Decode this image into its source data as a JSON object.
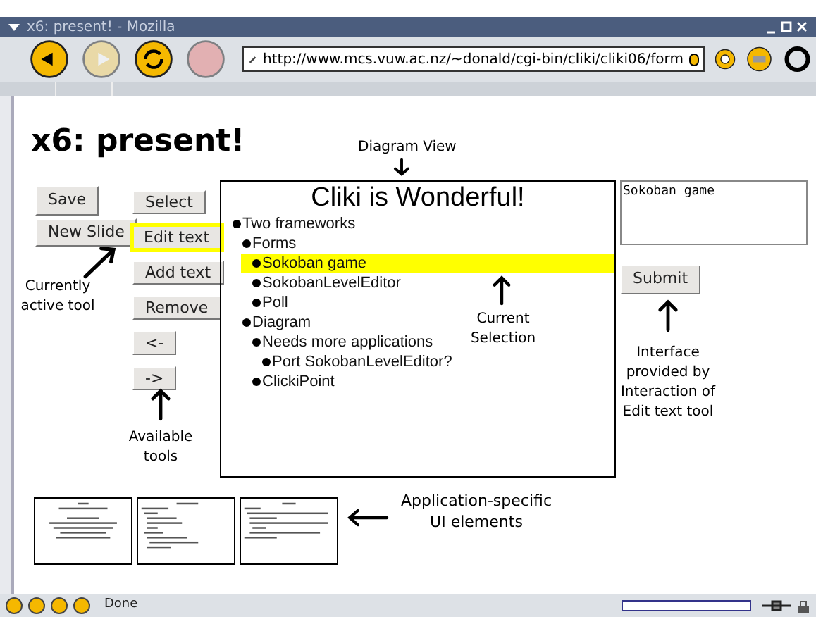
{
  "window": {
    "title": "x6: present! - Mozilla"
  },
  "toolbar": {
    "buttons": [
      {
        "kind": "back",
        "disabled": false
      },
      {
        "kind": "forward",
        "disabled": true
      },
      {
        "kind": "reload",
        "disabled": false
      },
      {
        "kind": "stop",
        "disabled": true
      }
    ],
    "url": "http://www.mcs.vuw.ac.nz/~donald/cgi-bin/cliki/cliki06/form"
  },
  "page": {
    "heading": "x6: present!",
    "slide_buttons": [
      "Save",
      "New Slide"
    ],
    "tools": [
      {
        "label": "Select",
        "selected": false
      },
      {
        "label": "Edit text",
        "selected": true
      },
      {
        "label": "Add text",
        "selected": false
      },
      {
        "label": "Remove",
        "selected": false
      },
      {
        "label": "<-",
        "selected": false
      },
      {
        "label": "->",
        "selected": false
      }
    ],
    "diagram": {
      "title": "Cliki is Wonderful!",
      "items": [
        {
          "text": "Two frameworks",
          "selected": false,
          "children": [
            {
              "text": "Forms",
              "selected": false,
              "children": [
                {
                  "text": "Sokoban game",
                  "selected": true
                },
                {
                  "text": "SokobanLevelEditor",
                  "selected": false
                },
                {
                  "text": "Poll",
                  "selected": false
                }
              ]
            },
            {
              "text": "Diagram",
              "selected": false,
              "children": [
                {
                  "text": "Needs more applications",
                  "selected": false,
                  "children": [
                    {
                      "text": "Port SokobanLevelEditor?",
                      "selected": false
                    }
                  ]
                },
                {
                  "text": "ClickiPoint",
                  "selected": false
                }
              ]
            }
          ]
        }
      ]
    },
    "edit_field": {
      "value": "Sokoban game"
    },
    "submit": "Submit",
    "annotations": {
      "diagram_view": "Diagram View",
      "active_tool": "Currently active tool",
      "current_selection": "Current Selection",
      "interface": "Interface provided by Interaction of Edit text tool",
      "available_tools": "Available tools",
      "app_specific": "Application-specific UI elements"
    }
  },
  "status_bar": {
    "text": "Done",
    "progress": {
      "level": 0
    }
  }
}
